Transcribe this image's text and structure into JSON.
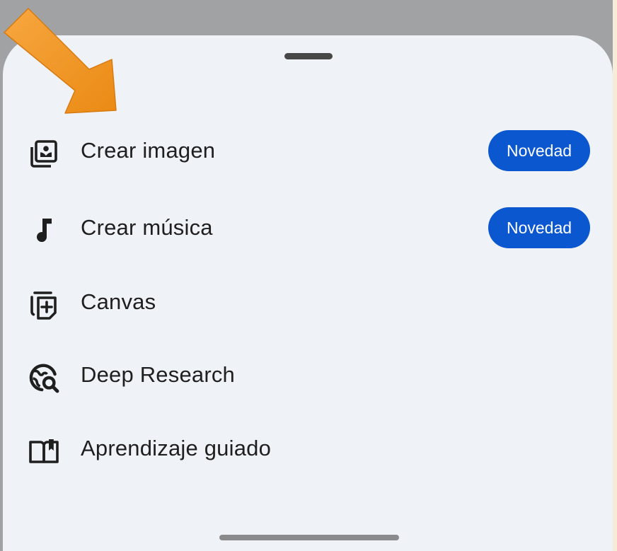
{
  "menu": {
    "items": [
      {
        "label": "Crear imagen",
        "icon": "image-gallery-icon",
        "badge": "Novedad"
      },
      {
        "label": "Crear música",
        "icon": "music-note-icon",
        "badge": "Novedad"
      },
      {
        "label": "Canvas",
        "icon": "canvas-add-icon"
      },
      {
        "label": "Deep Research",
        "icon": "globe-search-icon"
      },
      {
        "label": "Aprendizaje guiado",
        "icon": "open-book-icon"
      }
    ]
  },
  "colors": {
    "badge_background": "#0b57d0",
    "sheet_background": "#eff2f7",
    "scrim": "#a1a2a4",
    "annotation_arrow": "#f0921e"
  }
}
